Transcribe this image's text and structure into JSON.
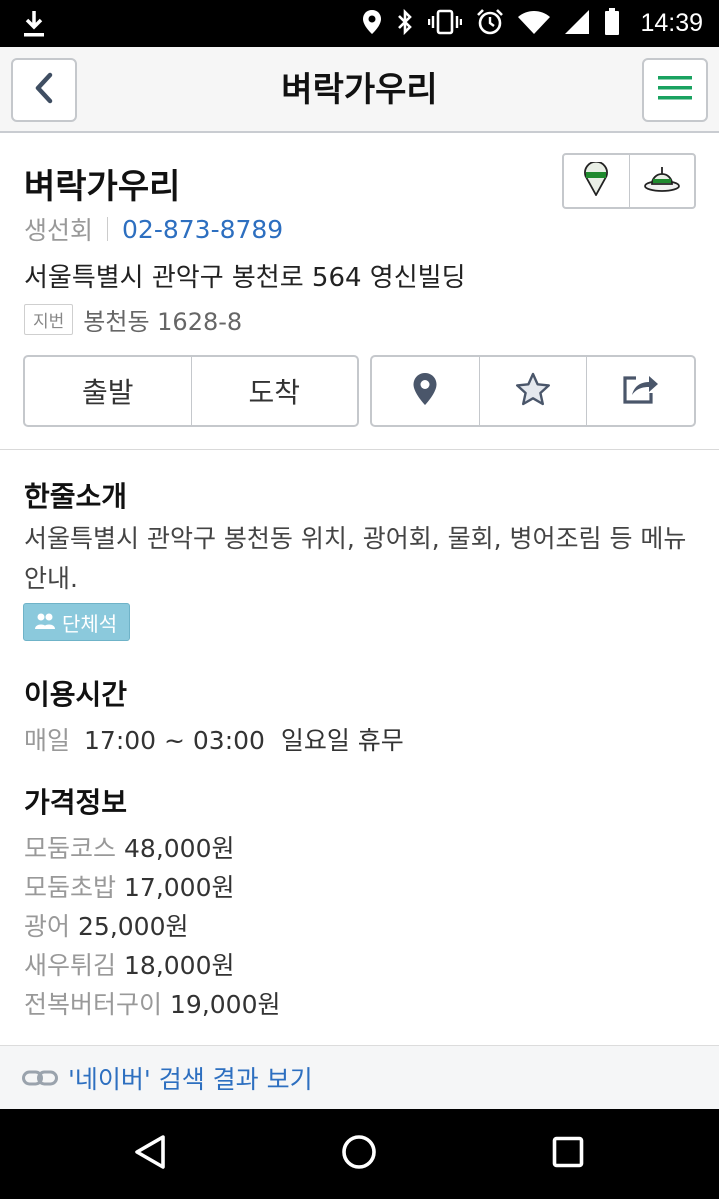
{
  "status_bar": {
    "time": "14:39",
    "icons": [
      "download-icon",
      "location-icon",
      "bluetooth-icon",
      "vibrate-icon",
      "alarm-icon",
      "wifi-icon",
      "signal-icon",
      "battery-icon"
    ]
  },
  "header": {
    "title": "벼락가우리",
    "back_icon": "chevron-left-icon",
    "menu_icon": "hamburger-menu-icon",
    "accent_color": "#1aa260"
  },
  "place": {
    "name": "벼락가우리",
    "category": "생선회",
    "phone": "02-873-8789",
    "address": "서울특별시 관악구 봉천로 564 영신빌딩",
    "jibun_label": "지번",
    "jibun_address": "봉천동 1628-8",
    "map_buttons": [
      "map-pin-icon",
      "satellite-icon"
    ],
    "route": {
      "start_label": "출발",
      "arrive_label": "도착"
    },
    "actions": [
      "location-icon",
      "star-icon",
      "share-icon"
    ]
  },
  "intro": {
    "heading": "한줄소개",
    "text": "서울특별시 관악구 봉천동 위치, 광어회, 물회, 병어조림 등 메뉴 안내.",
    "badge": "단체석",
    "badge_color": "#8bc9dc"
  },
  "hours": {
    "heading": "이용시간",
    "day_label": "매일",
    "time": "17:00 ~ 03:00",
    "note": "일요일 휴무"
  },
  "price": {
    "heading": "가격정보",
    "items": [
      {
        "name": "모둠코스",
        "value": "48,000원"
      },
      {
        "name": "모둠초밥",
        "value": "17,000원"
      },
      {
        "name": "광어",
        "value": "25,000원"
      },
      {
        "name": "새우튀김",
        "value": "18,000원"
      },
      {
        "name": "전복버터구이",
        "value": "19,000원"
      }
    ]
  },
  "naver_link": {
    "text": "'네이버' 검색 결과 보기",
    "color": "#2d6fc0"
  },
  "nav_bar": [
    "back-triangle-icon",
    "home-circle-icon",
    "recents-square-icon"
  ]
}
